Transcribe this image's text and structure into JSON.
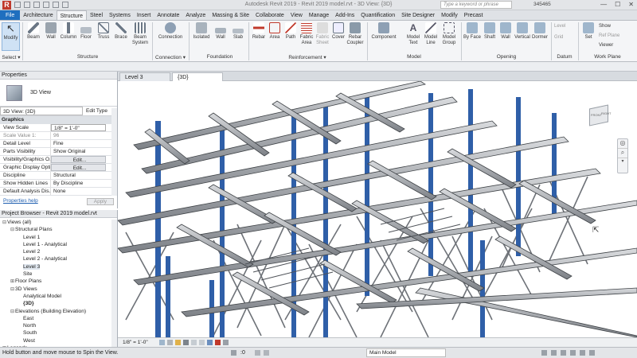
{
  "titlebar": {
    "app_letter": "R",
    "title": "Autodesk Revit 2019 - Revit 2019 model.rvt - 3D View: {3D}",
    "search_placeholder": "Type a keyword or phrase",
    "user": "345465",
    "min": "—",
    "max": "☐",
    "close": "✕"
  },
  "tabs": [
    "File",
    "Architecture",
    "Structure",
    "Steel",
    "Systems",
    "Insert",
    "Annotate",
    "Analyze",
    "Massing & Site",
    "Collaborate",
    "View",
    "Manage",
    "Add-Ins",
    "Quantification",
    "Site Designer",
    "Modify",
    "Precast"
  ],
  "ribbon": {
    "select": {
      "modify": "Modify",
      "label": "Select ▾"
    },
    "structure": {
      "items": [
        "Beam",
        "Wall",
        "Column",
        "Floor",
        "Truss",
        "Brace",
        "Beam System"
      ],
      "label": "Structure"
    },
    "connection": {
      "items": [
        "Connection"
      ],
      "label": "Connection ▾"
    },
    "foundation": {
      "items": [
        "Isolated",
        "Wall",
        "Slab"
      ],
      "label": "Foundation"
    },
    "reinforcement": {
      "items": [
        "Rebar",
        "Area",
        "Path",
        "Fabric Area",
        "Fabric Sheet",
        "Cover",
        "Rebar Coupler"
      ],
      "label": "Reinforcement ▾"
    },
    "model": {
      "items": [
        "Component",
        "Model Text",
        "Model Line",
        "Model Group"
      ],
      "label": "Model"
    },
    "opening": {
      "items": [
        "By Face",
        "Shaft",
        "Wall",
        "Vertical",
        "Dormer"
      ],
      "label": "Opening"
    },
    "datum": {
      "items": [
        "Level",
        "Grid"
      ],
      "label": "Datum"
    },
    "workplane": {
      "items": [
        "Set",
        "Show",
        "Ref Plane",
        "Viewer"
      ],
      "label": "Work Plane"
    }
  },
  "properties": {
    "title": "Properties",
    "type_name": "3D View",
    "instance_selector": "3D View: {3D}",
    "edit_type": "Edit Type",
    "section": "Graphics",
    "rows": [
      {
        "k": "View Scale",
        "v": "1/8\" = 1'-0\""
      },
      {
        "k": "Scale Value    1:",
        "v": "96"
      },
      {
        "k": "Detail Level",
        "v": "Fine"
      },
      {
        "k": "Parts Visibility",
        "v": "Show Original"
      },
      {
        "k": "Visibility/Graphics O...",
        "v": "Edit..."
      },
      {
        "k": "Graphic Display Opti...",
        "v": "Edit..."
      },
      {
        "k": "Discipline",
        "v": "Structural"
      },
      {
        "k": "Show Hidden Lines",
        "v": "By Discipline"
      },
      {
        "k": "Default Analysis Dis...",
        "v": "None"
      }
    ],
    "help": "Properties help",
    "apply": "Apply"
  },
  "browser": {
    "title": "Project Browser - Revit 2019 model.rvt",
    "items": [
      {
        "indent": 0,
        "toggle": "⊟",
        "label": "Views (all)"
      },
      {
        "indent": 1,
        "toggle": "⊟",
        "label": "Structural Plans"
      },
      {
        "indent": 2,
        "toggle": "",
        "label": "Level 1"
      },
      {
        "indent": 2,
        "toggle": "",
        "label": "Level 1 - Analytical"
      },
      {
        "indent": 2,
        "toggle": "",
        "label": "Level 2"
      },
      {
        "indent": 2,
        "toggle": "",
        "label": "Level 2 - Analytical"
      },
      {
        "indent": 2,
        "toggle": "",
        "label": "Level 3"
      },
      {
        "indent": 2,
        "toggle": "",
        "label": "Site"
      },
      {
        "indent": 1,
        "toggle": "⊞",
        "label": "Floor Plans"
      },
      {
        "indent": 1,
        "toggle": "⊟",
        "label": "3D Views"
      },
      {
        "indent": 2,
        "toggle": "",
        "label": "Analytical Model"
      },
      {
        "indent": 2,
        "toggle": "",
        "label": "{3D}"
      },
      {
        "indent": 1,
        "toggle": "⊟",
        "label": "Elevations (Building Elevation)"
      },
      {
        "indent": 2,
        "toggle": "",
        "label": "East"
      },
      {
        "indent": 2,
        "toggle": "",
        "label": "North"
      },
      {
        "indent": 2,
        "toggle": "",
        "label": "South"
      },
      {
        "indent": 2,
        "toggle": "",
        "label": "West"
      },
      {
        "indent": 0,
        "toggle": "⊞",
        "label": "Legends"
      }
    ]
  },
  "view_tabs": [
    "Level 3",
    "{3D}"
  ],
  "view_control": {
    "scale": "1/8\" = 1'-0\""
  },
  "viewcube": {
    "face1": "FRONT",
    "face2": "RIGHT"
  },
  "status": {
    "message": "Hold button and move mouse to Spin the View.",
    "zero": ":0",
    "model": "Main Model"
  }
}
